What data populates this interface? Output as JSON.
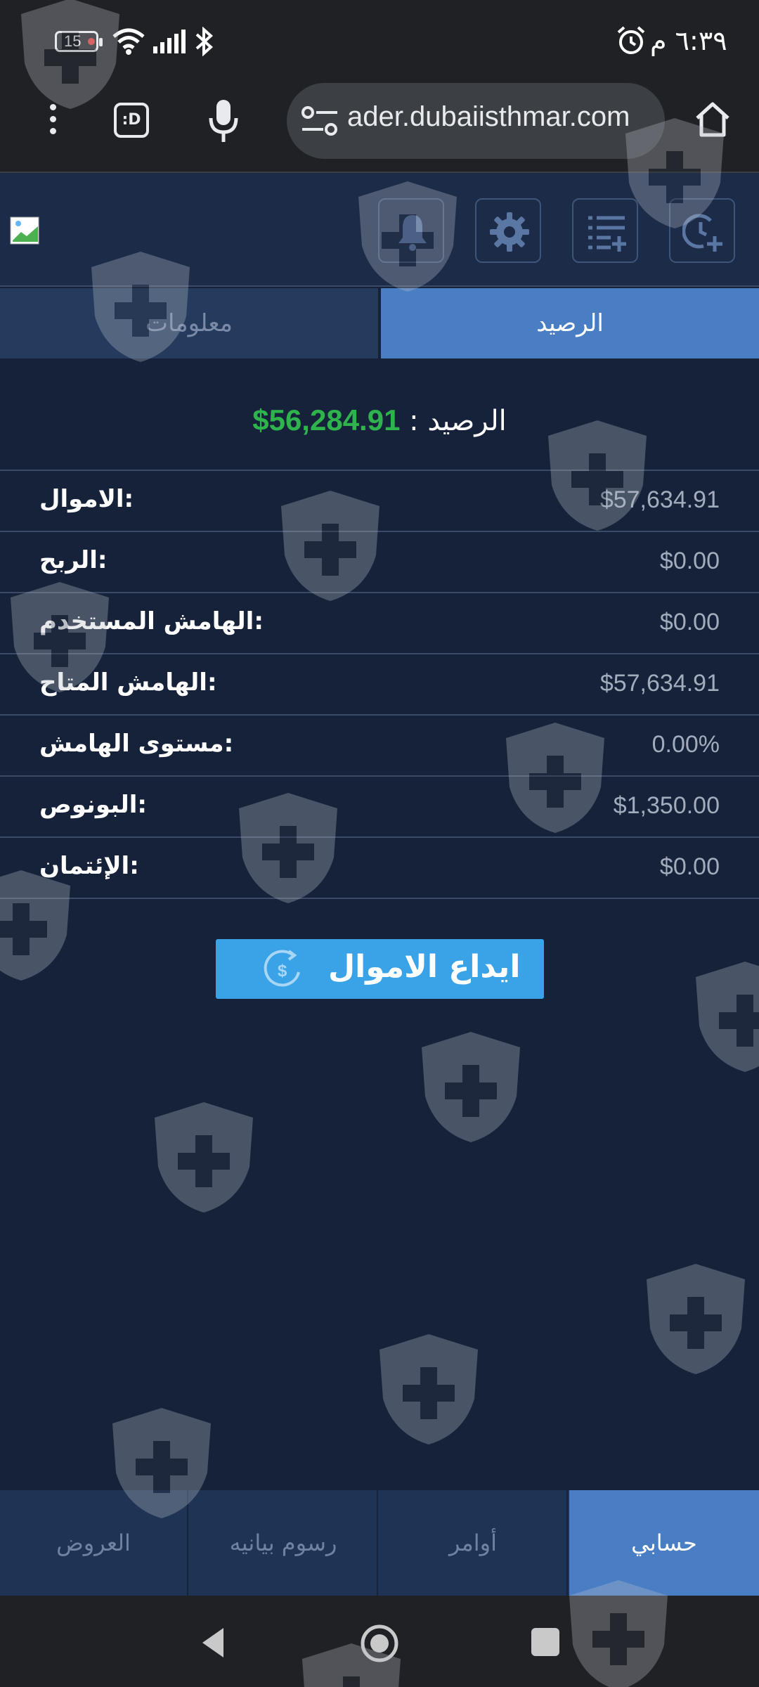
{
  "status_bar": {
    "battery": "15",
    "time": "٦:٣٩ م"
  },
  "browser": {
    "url": "ader.dubaiisthmar.com",
    "extension_label": ":D"
  },
  "tabs": {
    "info": "معلومات",
    "balance": "الرصيد"
  },
  "balance": {
    "label": "الرصيد :",
    "value": "56,284.91$"
  },
  "rows": [
    {
      "label": ":الاموال",
      "value": "$57,634.91"
    },
    {
      "label": ":الربح",
      "value": "$0.00"
    },
    {
      "label": ":الهامش المستخدم",
      "value": "$0.00"
    },
    {
      "label": ":الهامش المتاح",
      "value": "$57,634.91"
    },
    {
      "label": ":مستوى الهامش",
      "value": "0.00%"
    },
    {
      "label": ":البونوص",
      "value": "$1,350.00"
    },
    {
      "label": ":الإئتمان",
      "value": "$0.00"
    }
  ],
  "deposit_button": "ايداع الاموال",
  "bottom_nav": [
    {
      "label": "العروض"
    },
    {
      "label": "رسوم بيانيه"
    },
    {
      "label": "أوامر"
    },
    {
      "label": "حسابي"
    }
  ],
  "colors": {
    "background": "#162239",
    "header": "#1c2b48",
    "active_tab": "#4a7ec4",
    "balance_value": "#2eb34d",
    "deposit_button": "#3aa3e8"
  }
}
